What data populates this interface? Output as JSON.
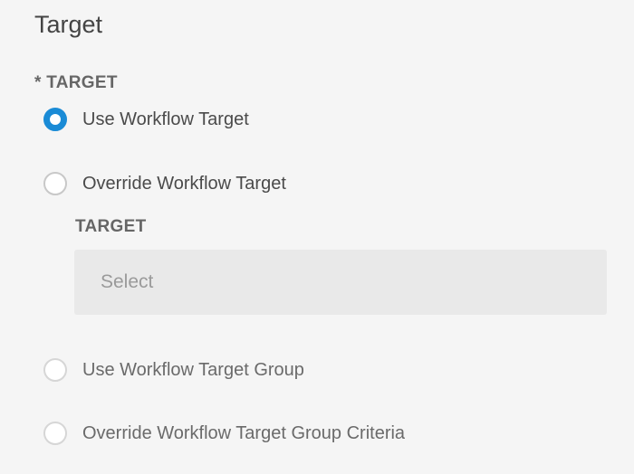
{
  "section": {
    "title": "Target"
  },
  "target_field": {
    "label": "* TARGET",
    "options": [
      {
        "label": "Use Workflow Target",
        "selected": true
      },
      {
        "label": "Override Workflow Target",
        "selected": false
      },
      {
        "label": "Use Workflow Target Group",
        "selected": false
      },
      {
        "label": "Override Workflow Target Group Criteria",
        "selected": false
      }
    ],
    "override_target": {
      "label": "TARGET",
      "select_placeholder": "Select"
    }
  },
  "colors": {
    "accent": "#1a8bd6",
    "background": "#f5f5f5",
    "select_background": "#e9e9e9"
  }
}
